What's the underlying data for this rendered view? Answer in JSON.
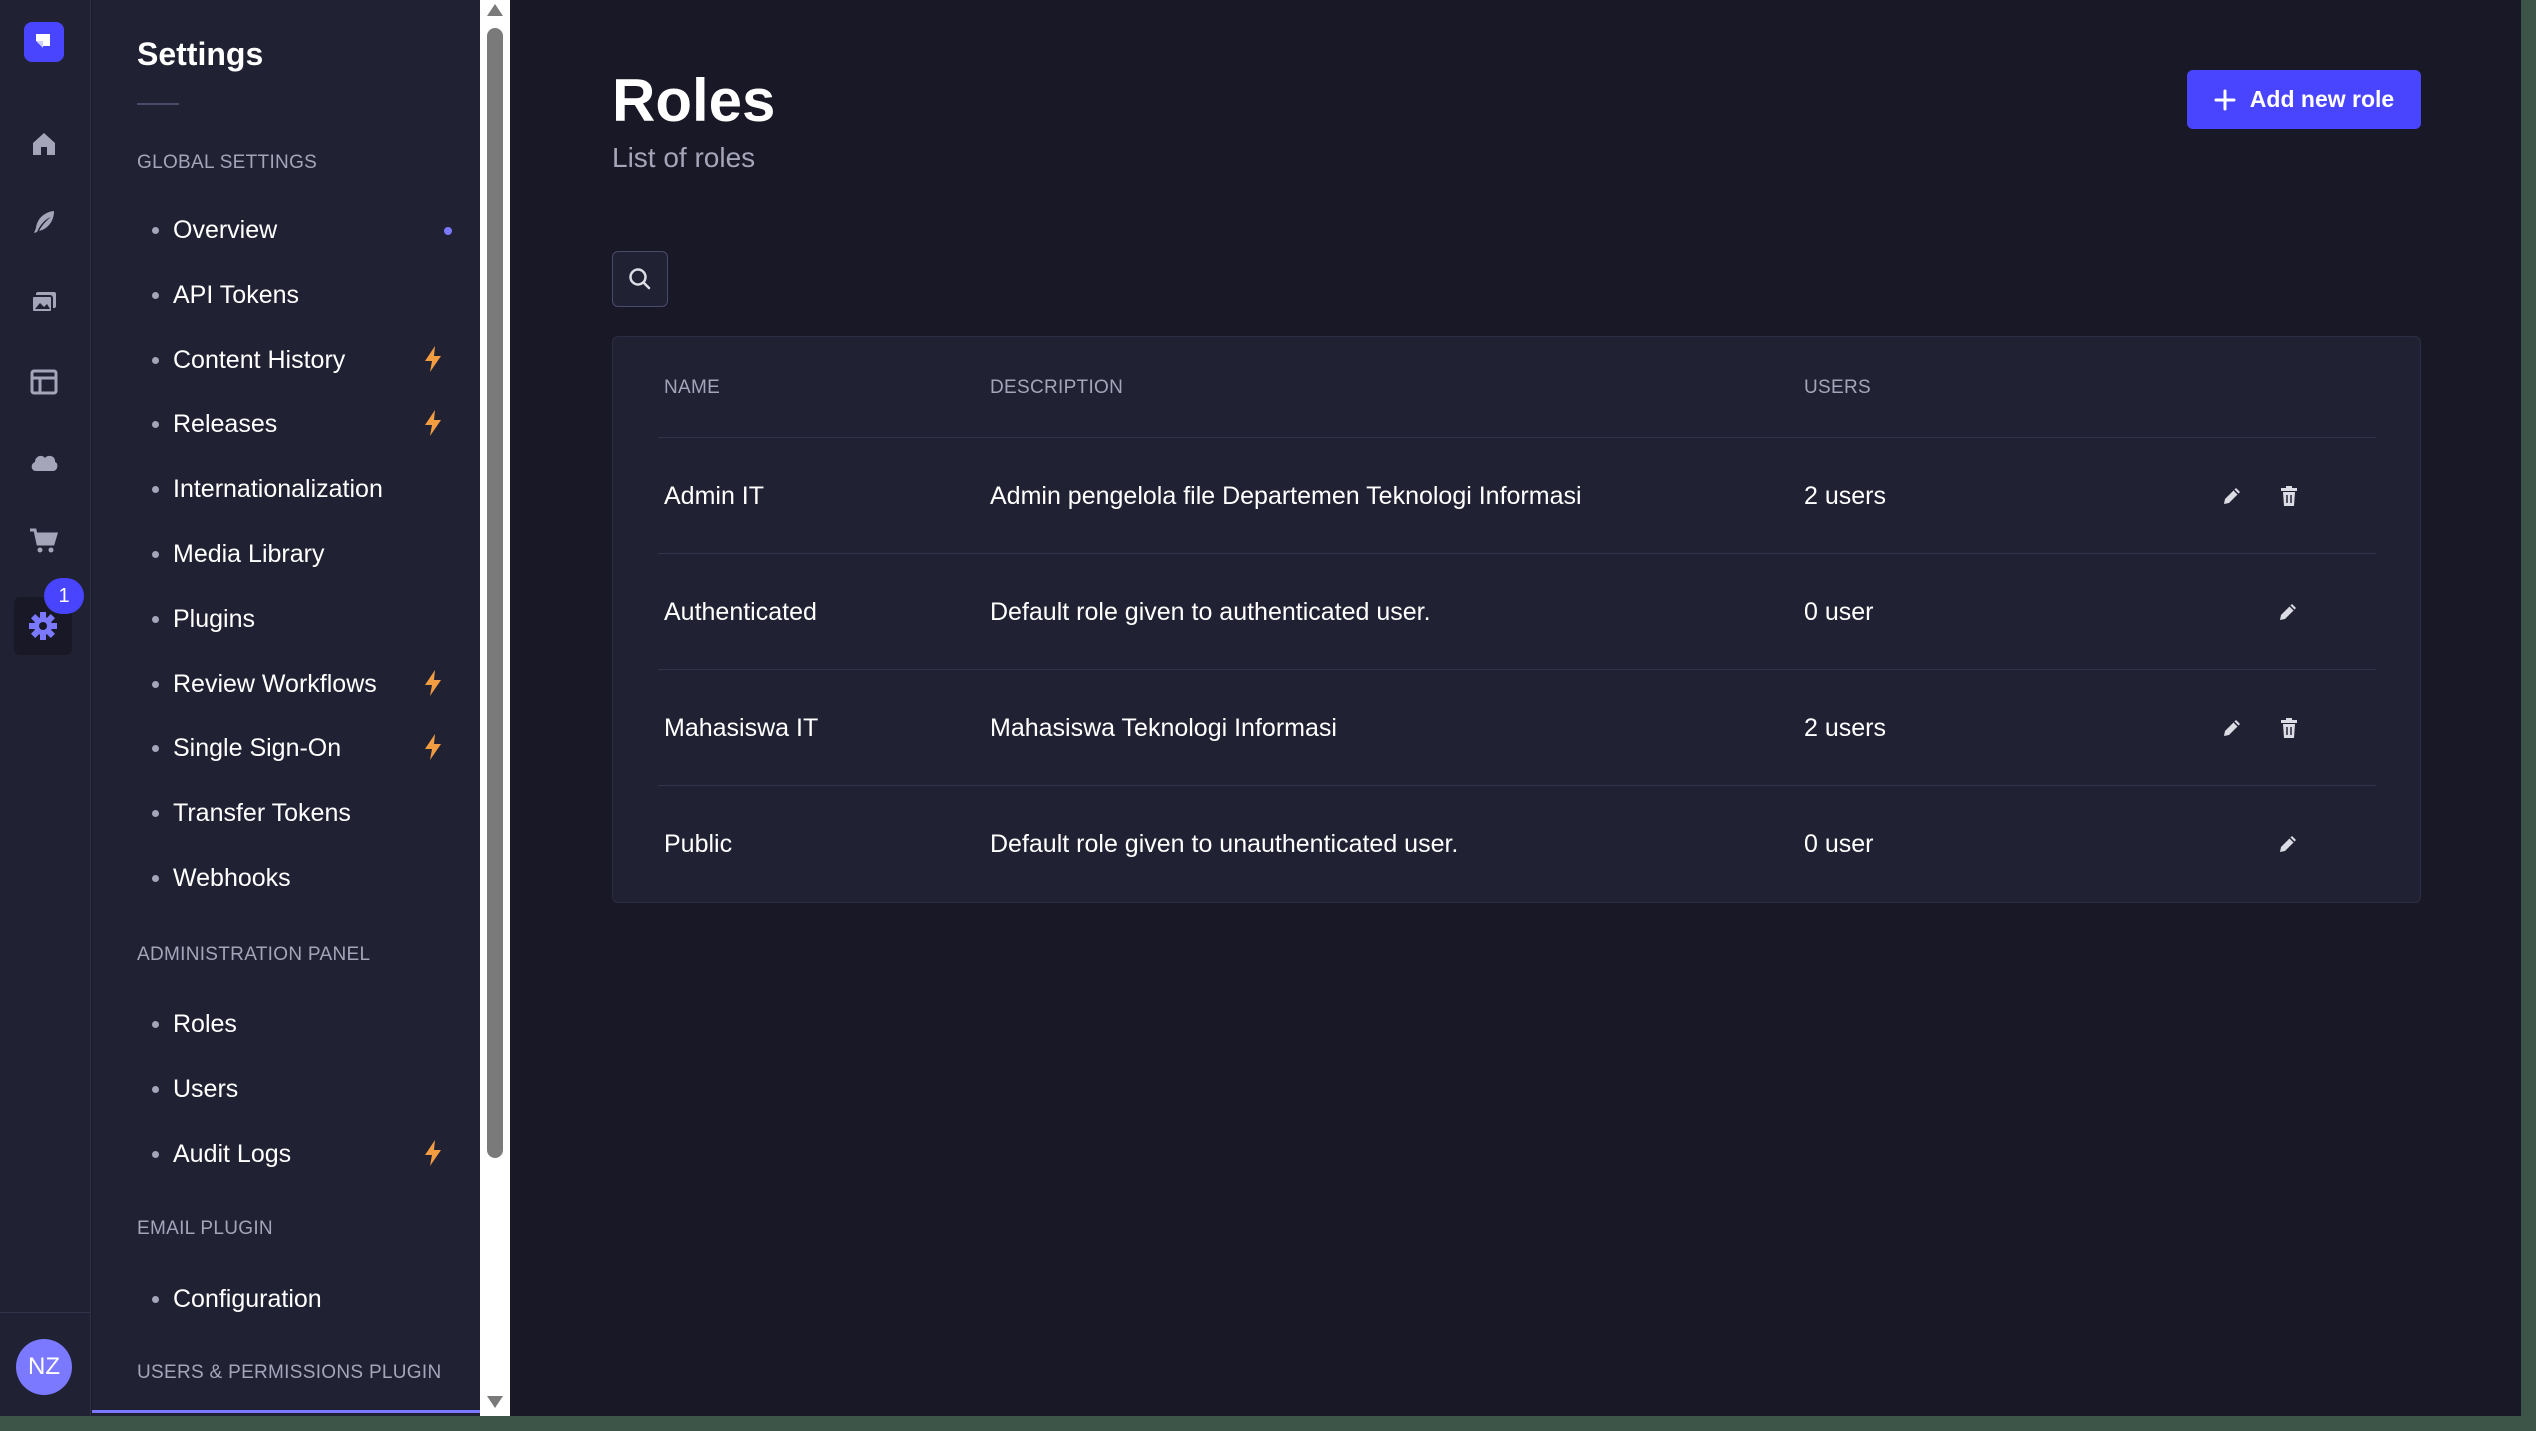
{
  "rail": {
    "badge_count": "1",
    "avatar_initials": "NZ",
    "icons": [
      "strapi-logo-icon",
      "home-icon",
      "feather-icon",
      "media-icon",
      "layout-icon",
      "cloud-icon",
      "cart-icon",
      "gear-icon"
    ]
  },
  "sidebar": {
    "title": "Settings",
    "sections": {
      "global": "GLOBAL SETTINGS",
      "admin": "ADMINISTRATION PANEL",
      "email": "EMAIL PLUGIN",
      "users_permissions": "USERS & PERMISSIONS PLUGIN"
    },
    "global_items": [
      {
        "label": "Overview",
        "badge": "new-dot"
      },
      {
        "label": "API Tokens"
      },
      {
        "label": "Content History",
        "badge": "lightning-icon"
      },
      {
        "label": "Releases",
        "badge": "lightning-icon"
      },
      {
        "label": "Internationalization"
      },
      {
        "label": "Media Library"
      },
      {
        "label": "Plugins"
      },
      {
        "label": "Review Workflows",
        "badge": "lightning-icon"
      },
      {
        "label": "Single Sign-On",
        "badge": "lightning-icon"
      },
      {
        "label": "Transfer Tokens"
      },
      {
        "label": "Webhooks"
      }
    ],
    "admin_items": [
      {
        "label": "Roles"
      },
      {
        "label": "Users"
      },
      {
        "label": "Audit Logs",
        "badge": "lightning-icon"
      }
    ],
    "email_items": [
      {
        "label": "Configuration"
      }
    ]
  },
  "header": {
    "title": "Roles",
    "subtitle": "List of roles",
    "add_button_label": "Add new role"
  },
  "table": {
    "columns": {
      "name": "NAME",
      "description": "DESCRIPTION",
      "users": "USERS"
    },
    "rows": [
      {
        "name": "Admin IT",
        "description": "Admin pengelola file Departemen Teknologi Informasi",
        "users": "2 users",
        "actions": [
          "edit",
          "delete"
        ]
      },
      {
        "name": "Authenticated",
        "description": "Default role given to authenticated user.",
        "users": "0 user",
        "actions": [
          "edit"
        ]
      },
      {
        "name": "Mahasiswa IT",
        "description": "Mahasiswa Teknologi Informasi",
        "users": "2 users",
        "actions": [
          "edit",
          "delete"
        ]
      },
      {
        "name": "Public",
        "description": "Default role given to unauthenticated user.",
        "users": "0 user",
        "actions": [
          "edit"
        ]
      }
    ]
  },
  "colors": {
    "accent": "#4945ff",
    "background": "#181826",
    "panel": "#212134",
    "lightning": "#f29d41"
  }
}
